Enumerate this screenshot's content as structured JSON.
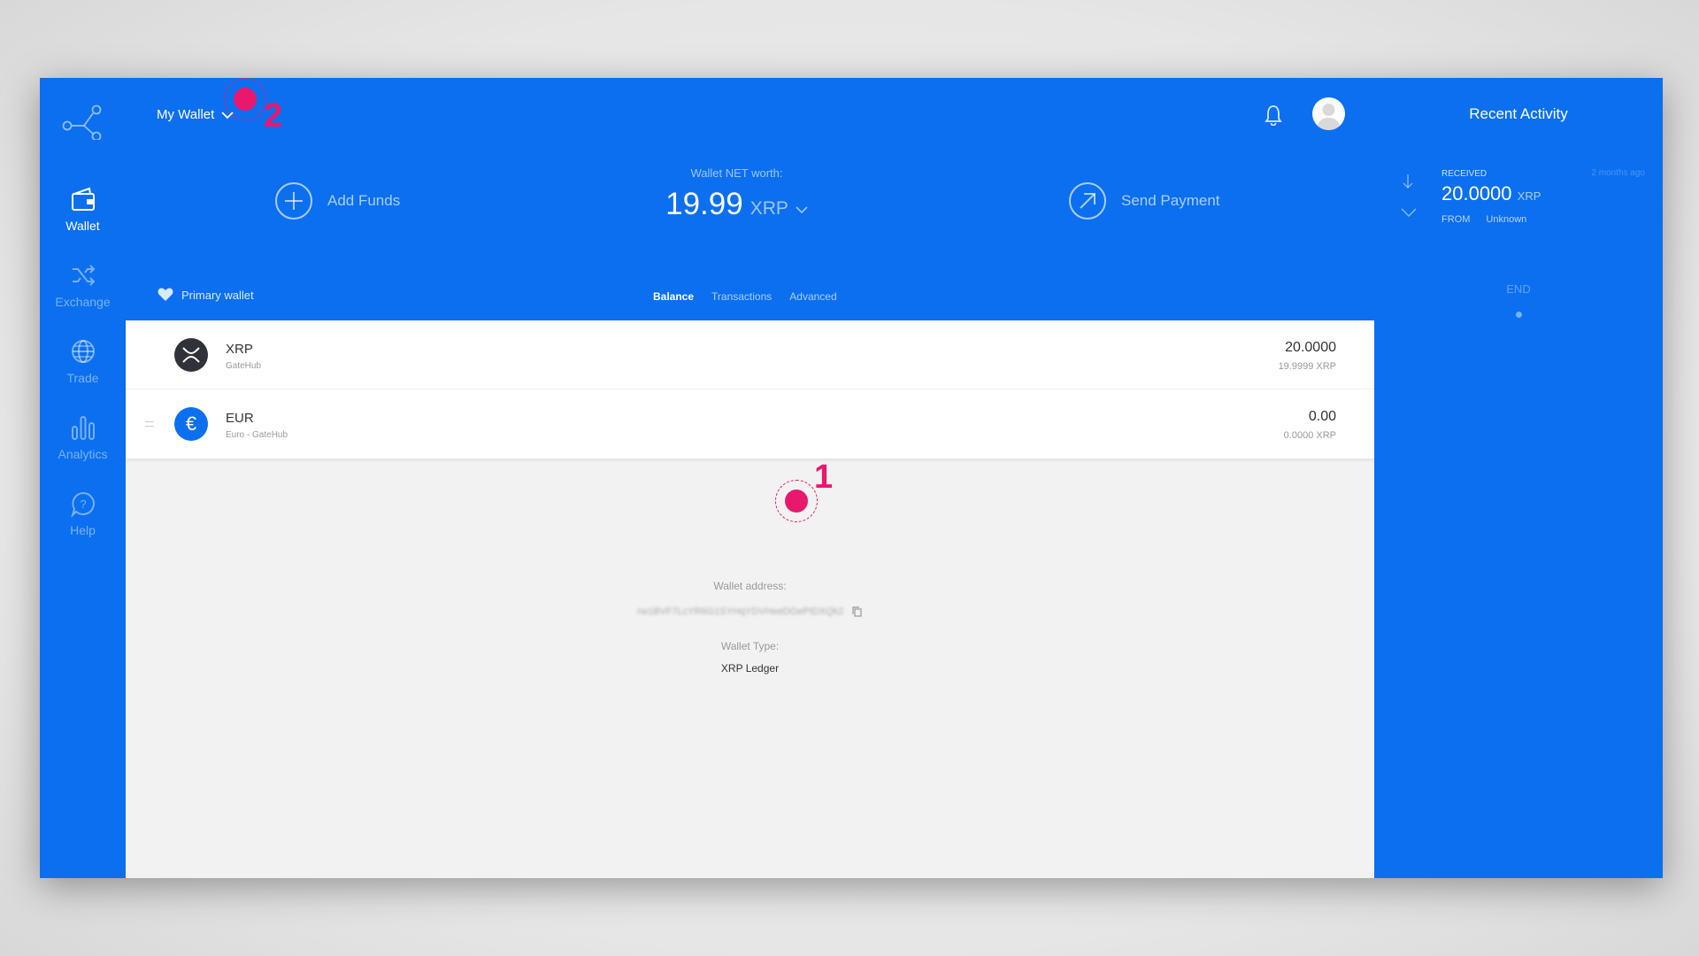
{
  "colors": {
    "brand_blue": "#0b6ff0",
    "marker_pink": "#e8186d",
    "content_bg": "#f2f2f2"
  },
  "sidebar": {
    "items": [
      {
        "label": "Wallet",
        "icon": "wallet-icon",
        "active": true
      },
      {
        "label": "Exchange",
        "icon": "shuffle-icon",
        "active": false
      },
      {
        "label": "Trade",
        "icon": "globe-icon",
        "active": false
      },
      {
        "label": "Analytics",
        "icon": "bar-chart-icon",
        "active": false
      },
      {
        "label": "Help",
        "icon": "help-bubble-icon",
        "active": false
      }
    ]
  },
  "header": {
    "wallet_selector": "My Wallet",
    "add_funds": "Add Funds",
    "send_payment": "Send Payment",
    "net_worth_label": "Wallet NET worth:",
    "net_worth_value": "19.99",
    "net_worth_currency": "XRP",
    "primary_wallet": "Primary wallet",
    "tabs": [
      "Balance",
      "Transactions",
      "Advanced"
    ],
    "active_tab": "Balance"
  },
  "assets": [
    {
      "name": "XRP",
      "issuer": "GateHub",
      "balance": "20.0000",
      "balance_xrp": "19.9999 XRP",
      "icon": "xrp-icon"
    },
    {
      "name": "EUR",
      "issuer": "Euro - GateHub",
      "balance": "0.00",
      "balance_xrp": "0.0000 XRP",
      "icon": "euro-icon"
    }
  ],
  "wallet_info": {
    "address_label": "Wallet address:",
    "address": "rw1BVF7LcYR6G1SYHqYDVHeeDGePtDXQk2",
    "type_label": "Wallet Type:",
    "type": "XRP Ledger"
  },
  "recent_activity": {
    "title": "Recent Activity",
    "items": [
      {
        "type": "RECEIVED",
        "time": "2 months ago",
        "amount": "20.0000",
        "unit": "XRP",
        "from_label": "FROM",
        "from": "Unknown"
      }
    ],
    "end_label": "END"
  },
  "markers": [
    {
      "number": "1"
    },
    {
      "number": "2"
    }
  ]
}
